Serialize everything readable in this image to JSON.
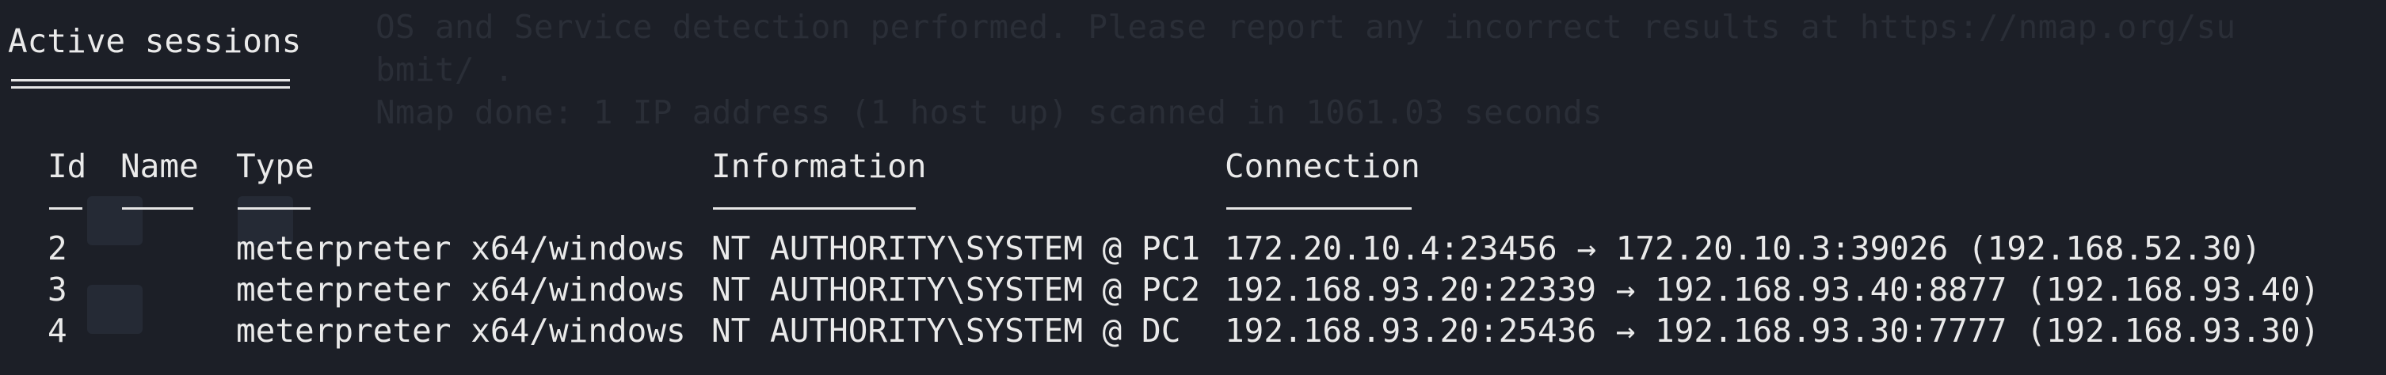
{
  "terminal": {
    "background_output": [
      "OS and Service detection performed. Please report any incorrect results at https://nmap.org/su",
      "bmit/ .",
      "Nmap done: 1 IP address (1 host up) scanned in 1061.03 seconds"
    ],
    "title": "Active sessions",
    "columns": {
      "id": "Id",
      "name": "Name",
      "type": "Type",
      "information": "Information",
      "connection": "Connection"
    },
    "sessions": [
      {
        "id": "2",
        "name": "",
        "type": "meterpreter x64/windows",
        "information": "NT AUTHORITY\\SYSTEM @ PC1",
        "connection": "172.20.10.4:23456 → 172.20.10.3:39026 (192.168.52.30)"
      },
      {
        "id": "3",
        "name": "",
        "type": "meterpreter x64/windows",
        "information": "NT AUTHORITY\\SYSTEM @ PC2",
        "connection": "192.168.93.20:22339 → 192.168.93.40:8877 (192.168.93.40)"
      },
      {
        "id": "4",
        "name": "",
        "type": "meterpreter x64/windows",
        "information": "NT AUTHORITY\\SYSTEM @ DC",
        "connection": "192.168.93.20:25436 → 192.168.93.30:7777 (192.168.93.30)"
      }
    ]
  },
  "colors": {
    "background": "#1c1f27",
    "text": "#eaeaea",
    "ghost": "#2a2e37"
  }
}
